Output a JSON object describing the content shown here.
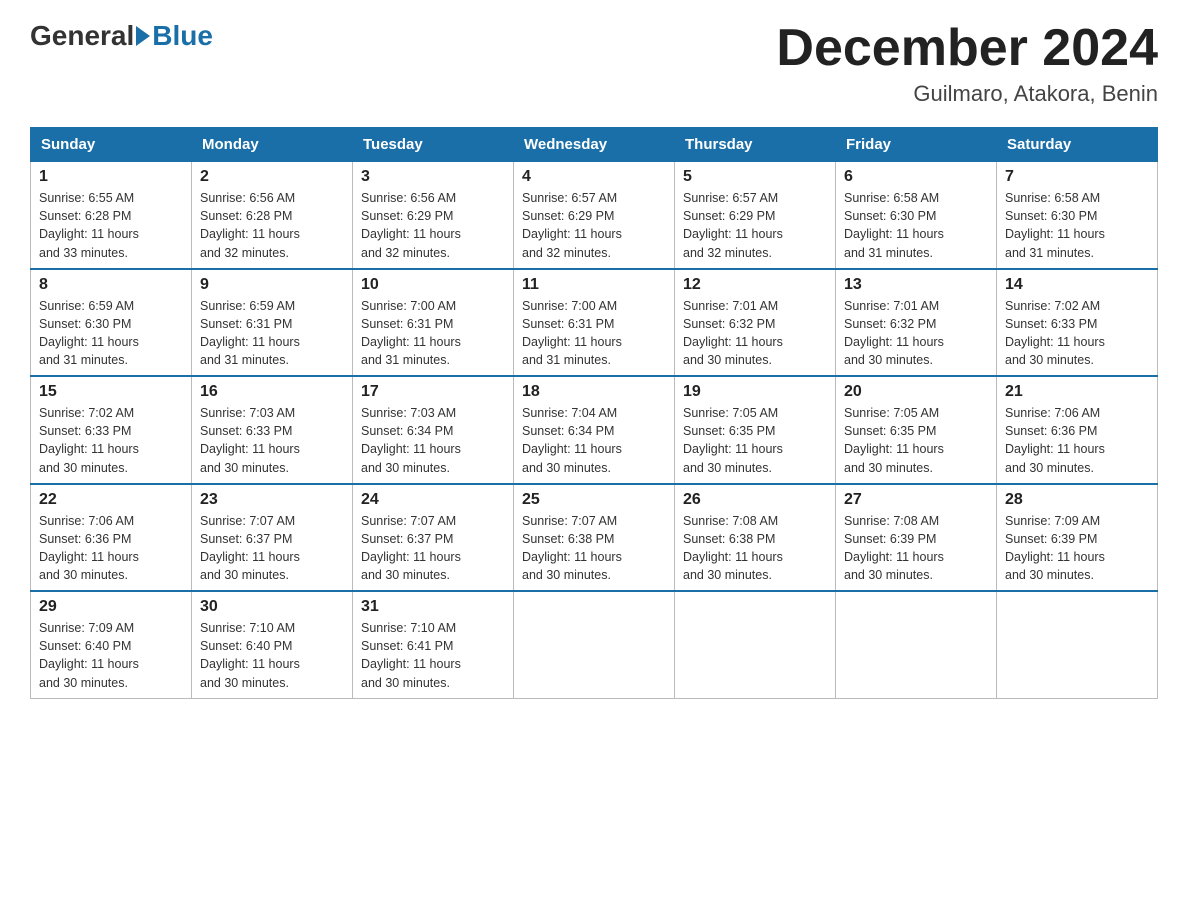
{
  "header": {
    "logo_general": "General",
    "logo_blue": "Blue",
    "month_title": "December 2024",
    "location": "Guilmaro, Atakora, Benin"
  },
  "days_of_week": [
    "Sunday",
    "Monday",
    "Tuesday",
    "Wednesday",
    "Thursday",
    "Friday",
    "Saturday"
  ],
  "weeks": [
    [
      {
        "day": "1",
        "sunrise": "6:55 AM",
        "sunset": "6:28 PM",
        "daylight": "11 hours and 33 minutes."
      },
      {
        "day": "2",
        "sunrise": "6:56 AM",
        "sunset": "6:28 PM",
        "daylight": "11 hours and 32 minutes."
      },
      {
        "day": "3",
        "sunrise": "6:56 AM",
        "sunset": "6:29 PM",
        "daylight": "11 hours and 32 minutes."
      },
      {
        "day": "4",
        "sunrise": "6:57 AM",
        "sunset": "6:29 PM",
        "daylight": "11 hours and 32 minutes."
      },
      {
        "day": "5",
        "sunrise": "6:57 AM",
        "sunset": "6:29 PM",
        "daylight": "11 hours and 32 minutes."
      },
      {
        "day": "6",
        "sunrise": "6:58 AM",
        "sunset": "6:30 PM",
        "daylight": "11 hours and 31 minutes."
      },
      {
        "day": "7",
        "sunrise": "6:58 AM",
        "sunset": "6:30 PM",
        "daylight": "11 hours and 31 minutes."
      }
    ],
    [
      {
        "day": "8",
        "sunrise": "6:59 AM",
        "sunset": "6:30 PM",
        "daylight": "11 hours and 31 minutes."
      },
      {
        "day": "9",
        "sunrise": "6:59 AM",
        "sunset": "6:31 PM",
        "daylight": "11 hours and 31 minutes."
      },
      {
        "day": "10",
        "sunrise": "7:00 AM",
        "sunset": "6:31 PM",
        "daylight": "11 hours and 31 minutes."
      },
      {
        "day": "11",
        "sunrise": "7:00 AM",
        "sunset": "6:31 PM",
        "daylight": "11 hours and 31 minutes."
      },
      {
        "day": "12",
        "sunrise": "7:01 AM",
        "sunset": "6:32 PM",
        "daylight": "11 hours and 30 minutes."
      },
      {
        "day": "13",
        "sunrise": "7:01 AM",
        "sunset": "6:32 PM",
        "daylight": "11 hours and 30 minutes."
      },
      {
        "day": "14",
        "sunrise": "7:02 AM",
        "sunset": "6:33 PM",
        "daylight": "11 hours and 30 minutes."
      }
    ],
    [
      {
        "day": "15",
        "sunrise": "7:02 AM",
        "sunset": "6:33 PM",
        "daylight": "11 hours and 30 minutes."
      },
      {
        "day": "16",
        "sunrise": "7:03 AM",
        "sunset": "6:33 PM",
        "daylight": "11 hours and 30 minutes."
      },
      {
        "day": "17",
        "sunrise": "7:03 AM",
        "sunset": "6:34 PM",
        "daylight": "11 hours and 30 minutes."
      },
      {
        "day": "18",
        "sunrise": "7:04 AM",
        "sunset": "6:34 PM",
        "daylight": "11 hours and 30 minutes."
      },
      {
        "day": "19",
        "sunrise": "7:05 AM",
        "sunset": "6:35 PM",
        "daylight": "11 hours and 30 minutes."
      },
      {
        "day": "20",
        "sunrise": "7:05 AM",
        "sunset": "6:35 PM",
        "daylight": "11 hours and 30 minutes."
      },
      {
        "day": "21",
        "sunrise": "7:06 AM",
        "sunset": "6:36 PM",
        "daylight": "11 hours and 30 minutes."
      }
    ],
    [
      {
        "day": "22",
        "sunrise": "7:06 AM",
        "sunset": "6:36 PM",
        "daylight": "11 hours and 30 minutes."
      },
      {
        "day": "23",
        "sunrise": "7:07 AM",
        "sunset": "6:37 PM",
        "daylight": "11 hours and 30 minutes."
      },
      {
        "day": "24",
        "sunrise": "7:07 AM",
        "sunset": "6:37 PM",
        "daylight": "11 hours and 30 minutes."
      },
      {
        "day": "25",
        "sunrise": "7:07 AM",
        "sunset": "6:38 PM",
        "daylight": "11 hours and 30 minutes."
      },
      {
        "day": "26",
        "sunrise": "7:08 AM",
        "sunset": "6:38 PM",
        "daylight": "11 hours and 30 minutes."
      },
      {
        "day": "27",
        "sunrise": "7:08 AM",
        "sunset": "6:39 PM",
        "daylight": "11 hours and 30 minutes."
      },
      {
        "day": "28",
        "sunrise": "7:09 AM",
        "sunset": "6:39 PM",
        "daylight": "11 hours and 30 minutes."
      }
    ],
    [
      {
        "day": "29",
        "sunrise": "7:09 AM",
        "sunset": "6:40 PM",
        "daylight": "11 hours and 30 minutes."
      },
      {
        "day": "30",
        "sunrise": "7:10 AM",
        "sunset": "6:40 PM",
        "daylight": "11 hours and 30 minutes."
      },
      {
        "day": "31",
        "sunrise": "7:10 AM",
        "sunset": "6:41 PM",
        "daylight": "11 hours and 30 minutes."
      },
      null,
      null,
      null,
      null
    ]
  ],
  "labels": {
    "sunrise": "Sunrise:",
    "sunset": "Sunset:",
    "daylight": "Daylight:"
  }
}
